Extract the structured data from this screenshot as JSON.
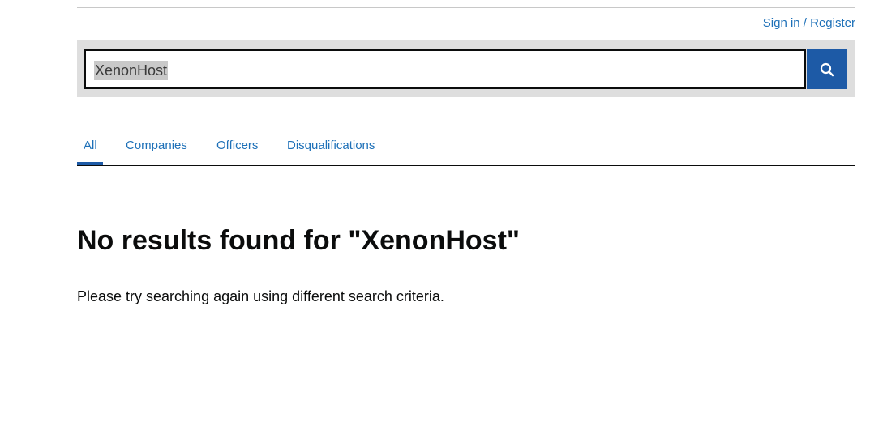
{
  "header": {
    "signin_label": "Sign in / Register"
  },
  "search": {
    "value": "XenonHost",
    "button_icon": "search-icon",
    "button_color": "#1d5aa6"
  },
  "tabs": [
    {
      "label": "All",
      "selected": true
    },
    {
      "label": "Companies",
      "selected": false
    },
    {
      "label": "Officers",
      "selected": false
    },
    {
      "label": "Disqualifications",
      "selected": false
    }
  ],
  "results": {
    "heading": "No results found for \"XenonHost\"",
    "message": "Please try searching again using different search criteria."
  },
  "colors": {
    "link": "#1d70b8",
    "text": "#0b0c0c",
    "search_band": "#dedede"
  }
}
